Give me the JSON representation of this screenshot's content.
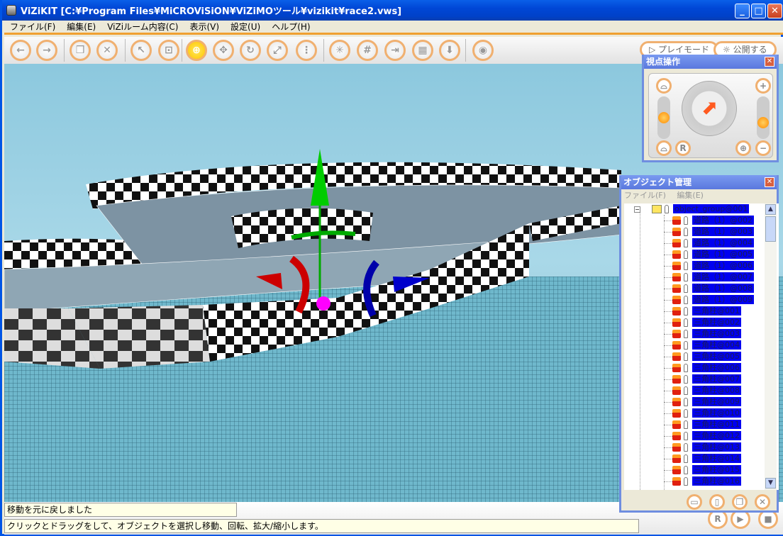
{
  "window": {
    "title": "ViZiKIT [C:¥Program Files¥MiCROViSiON¥ViZiMOツール¥vizikit¥race2.vws]",
    "min": "_",
    "max": "□",
    "close": "✕"
  },
  "menu": [
    "ファイル(F)",
    "編集(E)",
    "ViZiルーム内容(C)",
    "表示(V)",
    "設定(U)",
    "ヘルプ(H)"
  ],
  "toolbar": {
    "buttons": [
      {
        "name": "back",
        "glyph": "←"
      },
      {
        "name": "forward",
        "glyph": "→"
      },
      {
        "name": "object",
        "glyph": "❒"
      },
      {
        "name": "delete",
        "glyph": "✕"
      },
      {
        "name": "select",
        "glyph": "↖"
      },
      {
        "name": "select-multi",
        "glyph": "⊡"
      },
      {
        "name": "move-target",
        "glyph": "⊕"
      },
      {
        "name": "move",
        "glyph": "✥"
      },
      {
        "name": "rotate",
        "glyph": "↻"
      },
      {
        "name": "scale",
        "glyph": "⤢"
      },
      {
        "name": "xyz",
        "glyph": "⋮"
      },
      {
        "name": "axis",
        "glyph": "✳"
      },
      {
        "name": "grid-on",
        "glyph": "#"
      },
      {
        "name": "snap-off",
        "glyph": "⇥"
      },
      {
        "name": "box-off",
        "glyph": "▦"
      },
      {
        "name": "drop",
        "glyph": "⬇"
      },
      {
        "name": "camera",
        "glyph": "◉"
      }
    ],
    "play_mode": "▷ プレイモード",
    "publish": "☼ 公開する"
  },
  "viewpoint_panel": {
    "title": "視点操作",
    "reset": "R",
    "zoom_in": "+",
    "zoom_out": "−",
    "target": "⊕",
    "tilt_level": 0.5,
    "zoom_level": 0.35
  },
  "object_panel": {
    "title": "オブジェクト管理",
    "menu": [
      "ファイル(F)",
      "編集(E)"
    ],
    "group": "object_group@001",
    "items": [
      "道路（1）@002",
      "道路（1）@003",
      "道路（1）@004",
      "道路（1）@005",
      "道路（1）@006",
      "道路（1）@007",
      "道路（1）@008",
      "道路（1）@009",
      "三角柱@001",
      "三角柱@002",
      "三角柱@003",
      "三角柱@004",
      "三角柱@005",
      "三角柱@006",
      "三角柱@007",
      "三角柱@008",
      "三角柱@009",
      "三角柱@010",
      "三角柱@011",
      "三角柱@012",
      "三角柱@013",
      "三角柱@014",
      "三角柱@015",
      "三角柱@016"
    ],
    "tree_toggle": "−"
  },
  "status": {
    "message": "移動を元に戻しました",
    "hint": "クリックとドラッグをして、オブジェクトを選択し移動、回転、拡大/縮小します。"
  },
  "playback": {
    "reset": "R",
    "play": "▶",
    "stop": "■"
  }
}
